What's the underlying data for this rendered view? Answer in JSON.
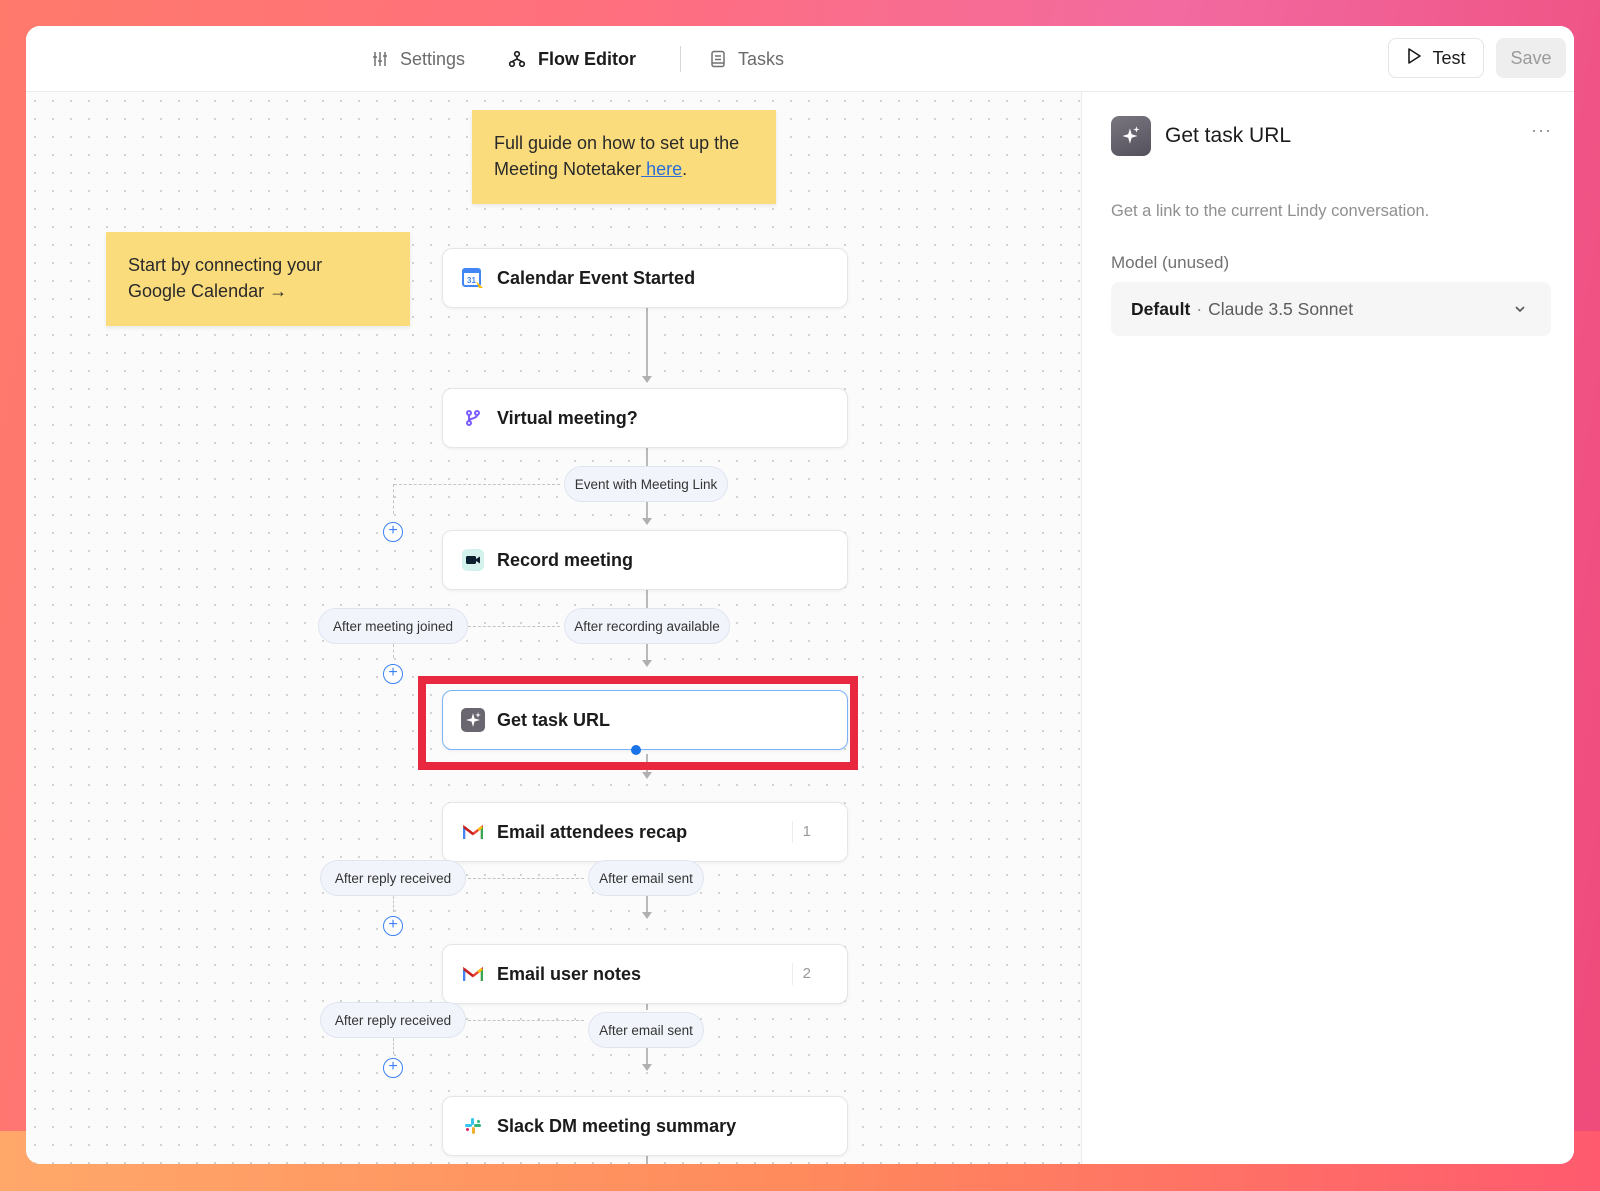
{
  "tabs": [
    {
      "label": "Settings",
      "icon": "sliders-icon",
      "active": false
    },
    {
      "label": "Flow Editor",
      "icon": "flow-icon",
      "active": true
    },
    {
      "label": "Tasks",
      "icon": "document-icon",
      "active": false
    }
  ],
  "actions": {
    "test_label": "Test",
    "save_label": "Save"
  },
  "notes": {
    "guide_text": "Full guide on how to set up the Meeting Notetaker",
    "guide_link": " here",
    "guide_end": ".",
    "calendar_line1": "Start by connecting your",
    "calendar_line2": "Google Calendar →"
  },
  "nodes": [
    {
      "label": "Calendar Event Started",
      "icon": "google-calendar-icon"
    },
    {
      "label": "Virtual meeting?",
      "icon": "branch-icon"
    },
    {
      "label": "Record meeting",
      "icon": "video-camera-icon"
    },
    {
      "label": "Get task URL",
      "icon": "sparkle-icon",
      "selected": true
    },
    {
      "label": "Email attendees recap",
      "icon": "gmail-icon",
      "count": "1"
    },
    {
      "label": "Email user notes",
      "icon": "gmail-icon",
      "count": "2"
    },
    {
      "label": "Slack DM meeting summary",
      "icon": "slack-icon"
    }
  ],
  "conditions": {
    "event_with_link": "Event with Meeting Link",
    "after_meeting_joined": "After meeting joined",
    "after_recording_available": "After recording available",
    "after_reply_received_1": "After reply received",
    "after_email_sent_1": "After email sent",
    "after_reply_received_2": "After reply received",
    "after_email_sent_2": "After email sent"
  },
  "panel": {
    "title": "Get task URL",
    "more": "···",
    "description": "Get a link to the current Lindy conversation.",
    "model_label": "Model (unused)",
    "model_default": "Default",
    "model_separator": "·",
    "model_name": "Claude 3.5 Sonnet"
  },
  "colors": {
    "accent_blue": "#1a73e8",
    "sticky": "#fbdc7c",
    "highlight": "#e8283e"
  }
}
